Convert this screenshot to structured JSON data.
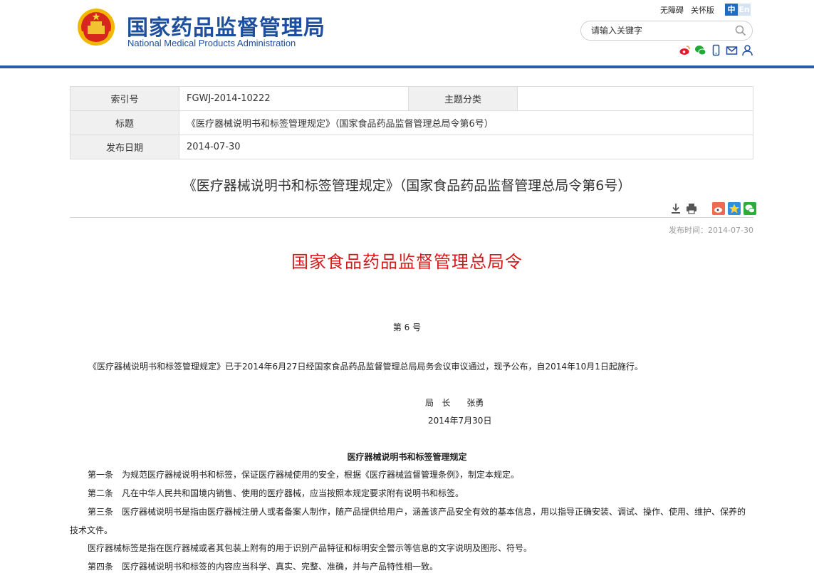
{
  "header": {
    "title_cn": "国家药品监督管理局",
    "title_en": "National Medical Products Administration",
    "links": [
      "无障碍",
      "关怀版"
    ],
    "lang_zh": "中",
    "lang_en": "En",
    "search_placeholder": "请输入关键字",
    "social_icons": [
      "weibo-icon",
      "wechat-icon",
      "mobile-icon",
      "mail-icon",
      "user-icon"
    ],
    "brand_color": "#1e4f9c"
  },
  "info": {
    "index_label": "索引号",
    "index_value": "FGWJ-2014-10222",
    "category_label": "主题分类",
    "category_value": "",
    "title_label": "标题",
    "title_value": "《医疗器械说明书和标签管理规定》（国家食品药品监督管理总局令第6号）",
    "date_label": "发布日期",
    "date_value": "2014-07-30"
  },
  "article": {
    "title": "《医疗器械说明书和标签管理规定》（国家食品药品监督管理总局令第6号）",
    "pub_time": "发布时间：2014-07-30",
    "red_title": "国家食品药品监督管理总局令",
    "order_no": "第 6 号",
    "intro": "《医疗器械说明书和标签管理规定》已于2014年6月27日经国家食品药品监督管理总局局务会议审议通过，现予公布，自2014年10月1日起施行。",
    "signer": "局   长      张勇",
    "sign_date": "2014年7月30日",
    "regulation_title": "医疗器械说明书和标签管理规定",
    "paragraphs": [
      "第一条　为规范医疗器械说明书和标签，保证医疗器械使用的安全，根据《医疗器械监督管理条例》，制定本规定。",
      "第二条　凡在中华人民共和国境内销售、使用的医疗器械，应当按照本规定要求附有说明书和标签。",
      "第三条　医疗器械说明书是指由医疗器械注册人或者备案人制作，随产品提供给用户，涵盖该产品安全有效的基本信息，用以指导正确安装、调试、操作、使用、维护、保养的技术文件。",
      "医疗器械标签是指在医疗器械或者其包装上附有的用于识别产品特征和标明安全警示等信息的文字说明及图形、符号。",
      "第四条　医疗器械说明书和标签的内容应当科学、真实、完整、准确，并与产品特性相一致。"
    ],
    "red_color": "#d31b1b"
  }
}
